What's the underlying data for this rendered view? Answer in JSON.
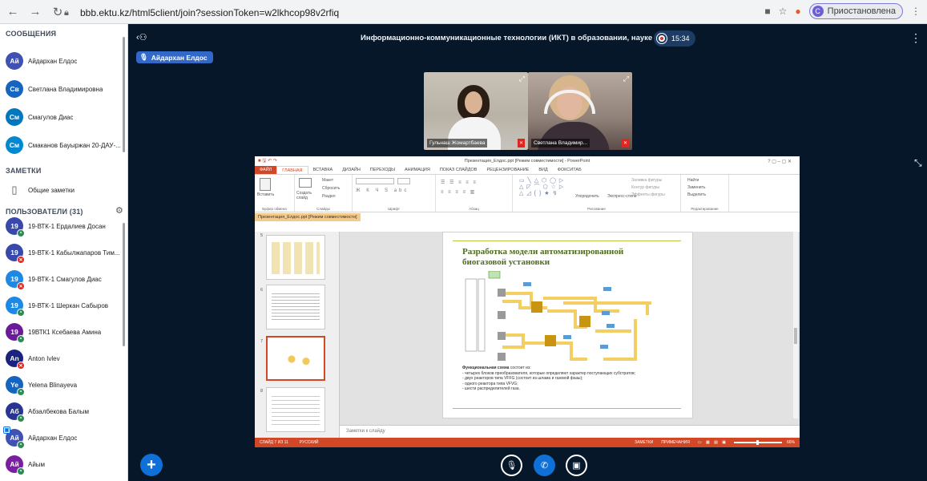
{
  "browser": {
    "url": "bbb.ektu.kz/html5client/join?sessionToken=w2lkhcop98v2rfiq",
    "profile_label": "Приостановлена",
    "profile_initial": "С"
  },
  "sidebar": {
    "messages_header": "СООБЩЕНИЯ",
    "chats": [
      {
        "initials": "Ай",
        "name": "Айдархан Елдос",
        "color": "#3f51b5"
      },
      {
        "initials": "Св",
        "name": "Светлана Владимировна",
        "color": "#1565c0"
      },
      {
        "initials": "См",
        "name": "Смагулов Диас",
        "color": "#0277bd"
      },
      {
        "initials": "См",
        "name": "Смаканов Бауыржан 20-ДАУ-...",
        "color": "#0288d1"
      }
    ],
    "notes_header": "ЗАМЕТКИ",
    "shared_notes": "Общие заметки",
    "users_header": "ПОЛЬЗОВАТЕЛИ (31)",
    "users": [
      {
        "initials": "19",
        "name": "19-ВТК-1 Ердалиев Досан",
        "color": "#3949ab",
        "mic": "on"
      },
      {
        "initials": "19",
        "name": "19-ВТК-1 Кабылжапаров Тим...",
        "color": "#3949ab",
        "mic": "off"
      },
      {
        "initials": "19",
        "name": "19-ВТК-1 Смагулов Диас",
        "color": "#1e88e5",
        "mic": "off"
      },
      {
        "initials": "19",
        "name": "19-ВТК-1 Шеркан Сабыров",
        "color": "#1e88e5",
        "mic": "on"
      },
      {
        "initials": "19",
        "name": "19ВТК1 Ксебаева Амина",
        "color": "#6a1b9a",
        "mic": "on"
      },
      {
        "initials": "An",
        "name": "Anton Ivlev",
        "color": "#1a237e",
        "mic": "off"
      },
      {
        "initials": "Ye",
        "name": "Yelena Blinayeva",
        "color": "#1565c0",
        "mic": "on"
      },
      {
        "initials": "Аб",
        "name": "Абзалбекова Балым",
        "color": "#283593",
        "mic": "on"
      },
      {
        "initials": "Ай",
        "name": "Айдархан Елдос",
        "color": "#3f51b5",
        "mic": "on",
        "presenter": true
      },
      {
        "initials": "Ай",
        "name": "Айым",
        "color": "#7b1fa2",
        "mic": "on"
      }
    ]
  },
  "main": {
    "meeting_title": "Информационно-коммуникационные технологии (ИКТ) в образовании, науке и те...",
    "recording_time": "15:34",
    "talking_indicator": "Айдархан Елдос",
    "videos": [
      {
        "name": "Гульнаш Жомартбаева"
      },
      {
        "name": "Светлана Владимир..."
      }
    ]
  },
  "powerpoint": {
    "window_title": "Презентация_Елдос.ppt [Режим совместимости] - PowerPoint",
    "tabs": [
      "ФАЙЛ",
      "ГЛАВНАЯ",
      "ВСТАВКА",
      "ДИЗАЙН",
      "ПЕРЕХОДЫ",
      "АНИМАЦИЯ",
      "ПОКАЗ СЛАЙДОВ",
      "РЕЦЕНЗИРОВАНИЕ",
      "ВИД",
      "ФОКСИТАБ"
    ],
    "ribbon_groups": [
      "Буфер обмена",
      "Слайды",
      "Шрифт",
      "Абзац",
      "Рисование",
      "Редактирование"
    ],
    "ribbon_buttons": {
      "paste": "Вставить",
      "new_slide": "Создать слайд",
      "layout": "Макет",
      "reset": "Сбросить",
      "section": "Раздел",
      "arrange": "Упорядочить",
      "quick_styles": "Экспресс-стили",
      "shape_fill": "Заливка фигуры",
      "shape_outline": "Контур фигуры",
      "shape_effects": "Эффекты фигуры",
      "find": "Найти",
      "replace": "Заменить",
      "select": "Выделить"
    },
    "doc_tab": "Презентация_Елдос.ppt [Режим совместимости]",
    "thumb_numbers": [
      "5",
      "6",
      "7",
      "8"
    ],
    "slide": {
      "title_line1": "Разработка модели автоматизированной",
      "title_line2": "биогазовой установки",
      "lead": "Функциональная схема",
      "lead_rest": " состоит из:",
      "items": [
        "- четырех блоков преобразователя, которые определяют характер поступающих субстратов;",
        "- двух реакторов типа VFFG (состоит из шлама и газовой фазы);",
        "- одного реактора типа VFVG;",
        "- шести распределителей газа."
      ]
    },
    "notes_placeholder": "Заметки к слайду",
    "status_left": "СЛАЙД 7 ИЗ 11",
    "status_lang": "РУССКИЙ",
    "status_notes": "ЗАМЕТКИ",
    "status_comments": "ПРИМЕЧАНИЯ",
    "zoom": "66%"
  }
}
